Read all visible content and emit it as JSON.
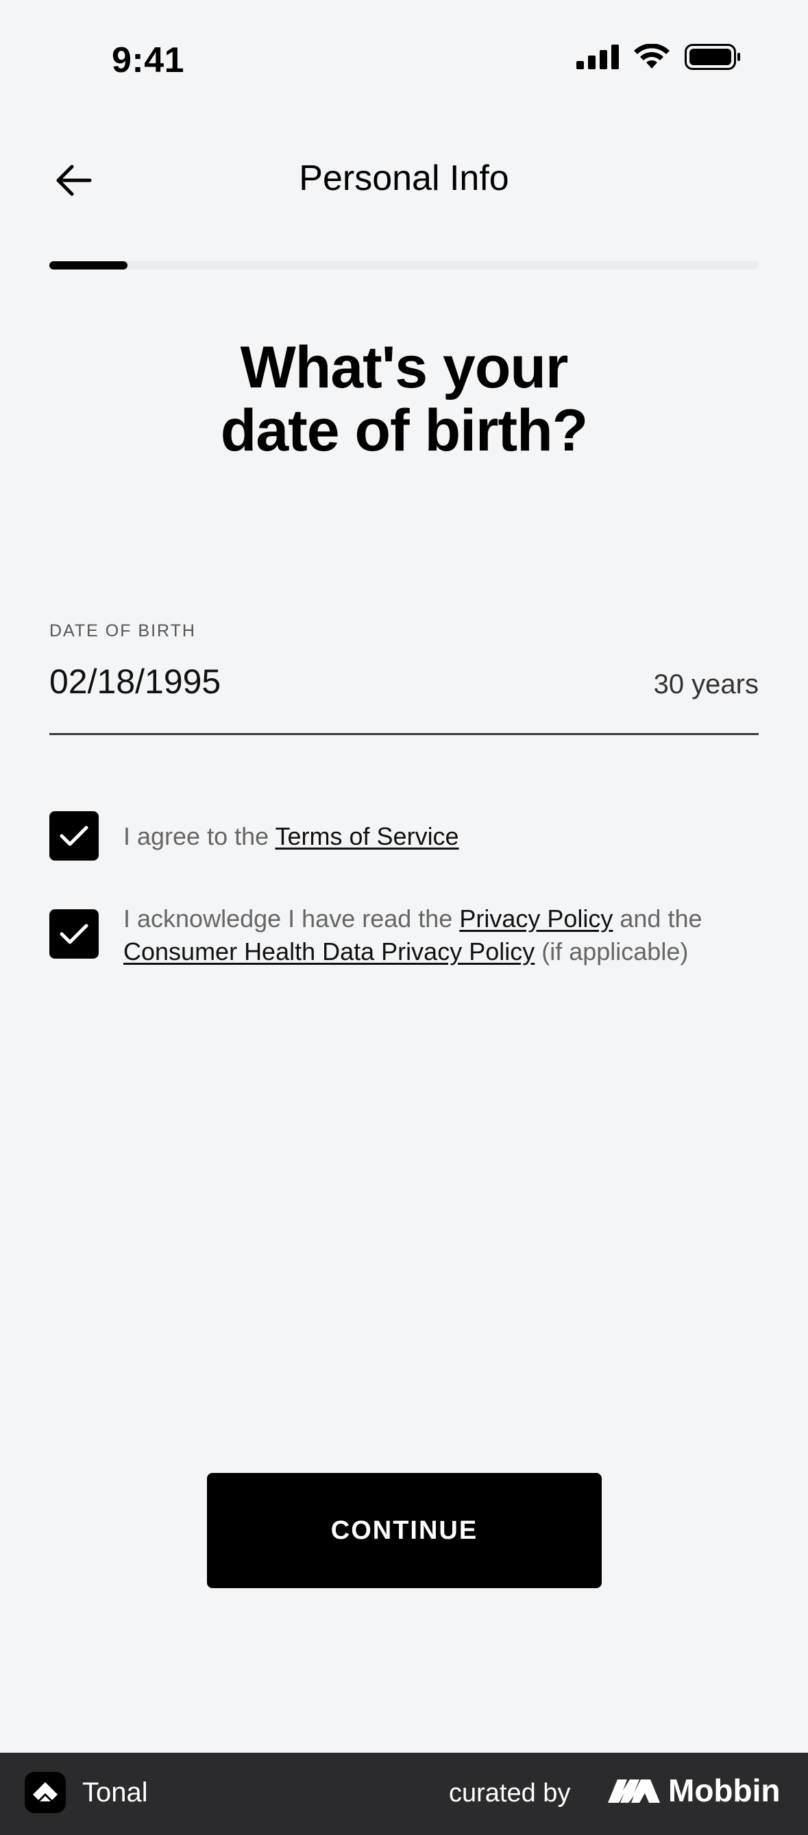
{
  "status_bar": {
    "time": "9:41"
  },
  "nav": {
    "title": "Personal Info"
  },
  "progress": {
    "fraction": 0.11
  },
  "heading": {
    "line1": "What's your",
    "line2": "date of birth?"
  },
  "dob_field": {
    "label": "DATE OF BIRTH",
    "value": "02/18/1995",
    "age": "30 years"
  },
  "consents": {
    "terms": {
      "checked": true,
      "prefix": "I agree to the ",
      "link": "Terms of Service"
    },
    "privacy": {
      "checked": true,
      "prefix": "I acknowledge I have read the ",
      "link1": "Privacy Policy",
      "middle": " and the ",
      "link2": "Consumer Health Data Privacy Policy",
      "suffix": " (if applicable)"
    }
  },
  "continue_button": {
    "label": "CONTINUE"
  },
  "footer": {
    "app_name": "Tonal",
    "curated_by": "curated by",
    "brand": "Mobbin"
  },
  "colors": {
    "background": "#f4f5f7",
    "accent": "#000000",
    "footer_bg": "#2b2b2d"
  }
}
